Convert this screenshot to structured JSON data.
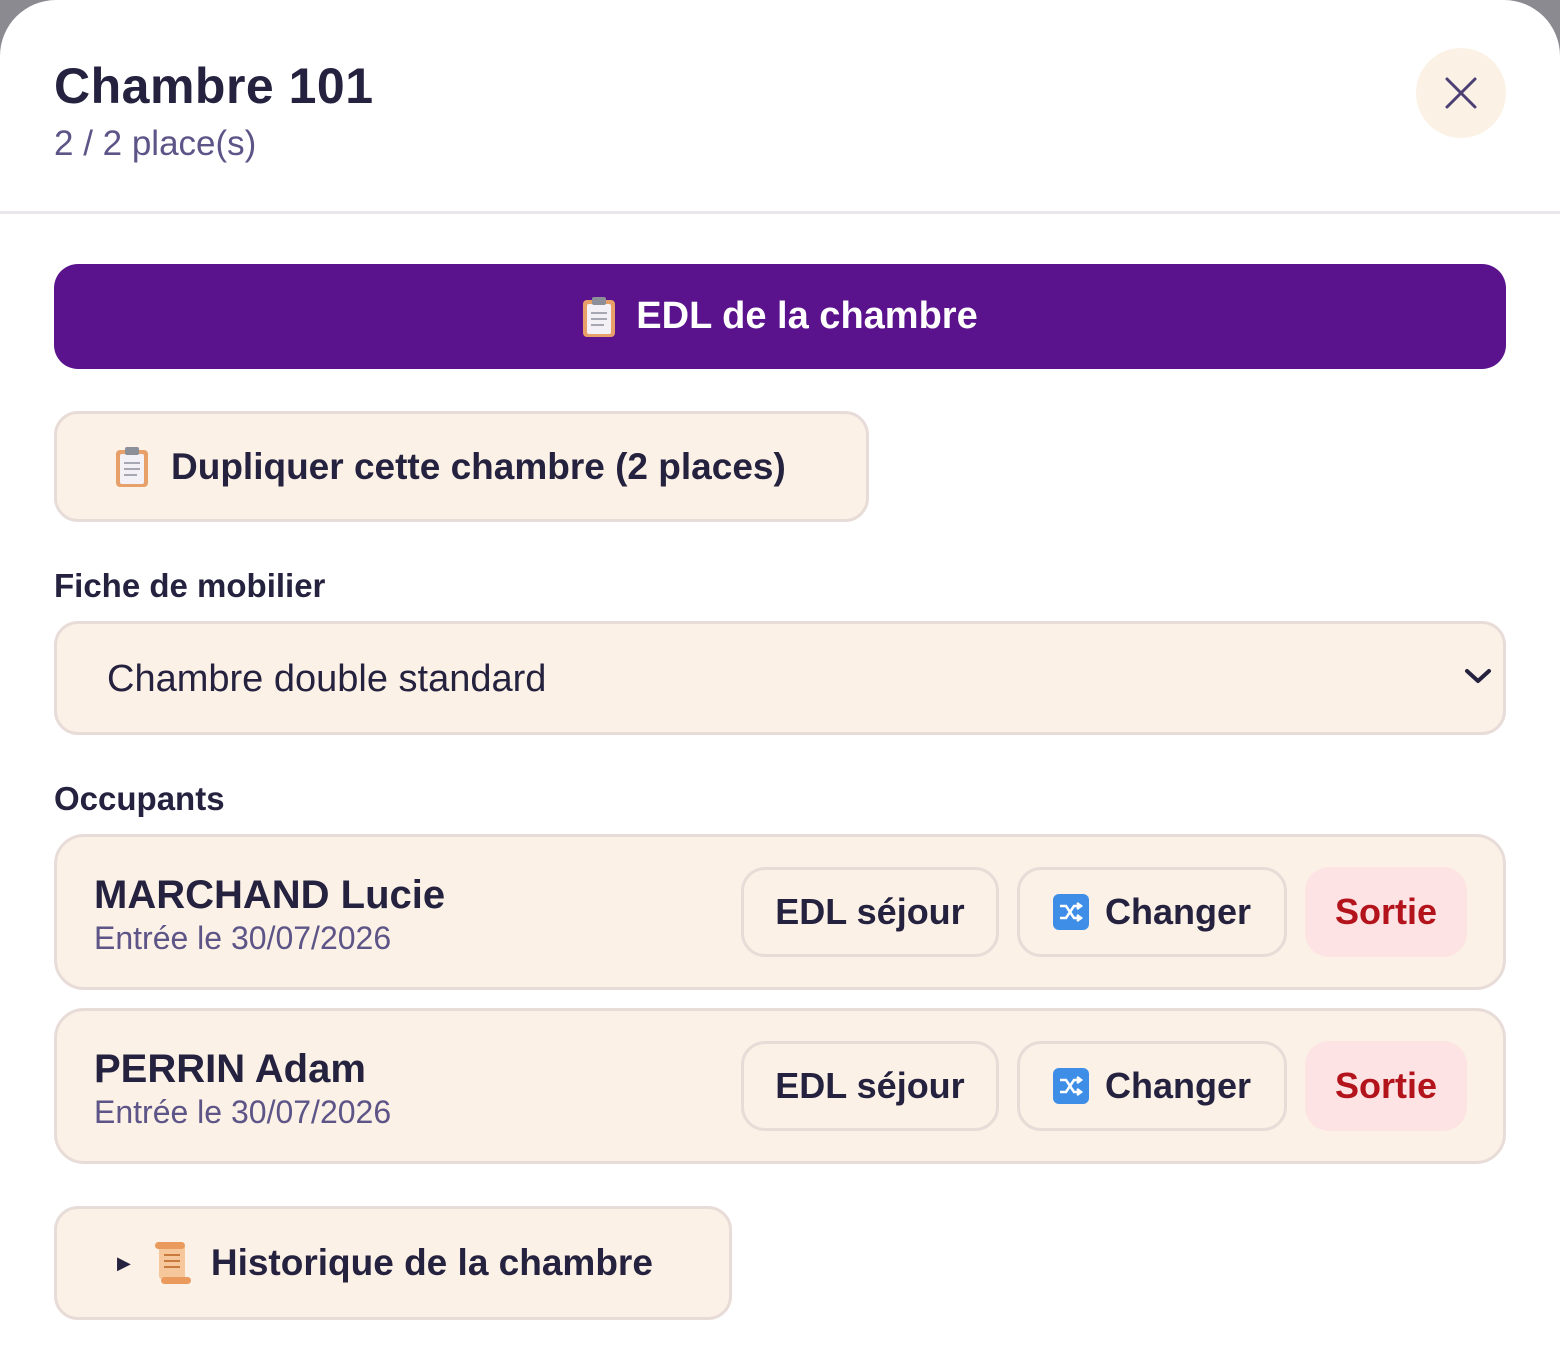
{
  "modal": {
    "title": "Chambre 101",
    "subtitle": "2 / 2 place(s)",
    "close_icon": "close-icon"
  },
  "actions": {
    "edl_room_label": "EDL de la chambre",
    "edl_room_icon": "clipboard-icon",
    "duplicate_label": "Dupliquer cette chambre (2 places)",
    "duplicate_icon": "clipboard-icon"
  },
  "furniture": {
    "label": "Fiche de mobilier",
    "selected": "Chambre double standard"
  },
  "occupants": {
    "label": "Occupants",
    "list": [
      {
        "name": "MARCHAND Lucie",
        "entry": "Entrée le 30/07/2026",
        "edl_label": "EDL séjour",
        "change_label": "Changer",
        "exit_label": "Sortie"
      },
      {
        "name": "PERRIN Adam",
        "entry": "Entrée le 30/07/2026",
        "edl_label": "EDL séjour",
        "change_label": "Changer",
        "exit_label": "Sortie"
      }
    ]
  },
  "history": {
    "label": "Historique de la chambre",
    "icon": "scroll-icon"
  },
  "colors": {
    "primary": "#5a138c",
    "card_bg": "#fbf1e6",
    "text_dark": "#25223f",
    "text_muted": "#5d5487",
    "danger": "#b3141c",
    "danger_bg": "#fde3e3"
  }
}
